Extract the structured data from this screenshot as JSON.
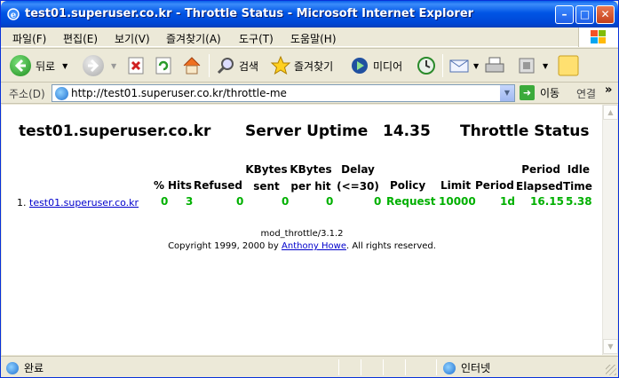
{
  "window": {
    "title": "test01.superuser.co.kr - Throttle Status - Microsoft Internet Explorer",
    "min_glyph": "–",
    "max_glyph": "□",
    "close_glyph": "✕"
  },
  "menu": {
    "items": [
      "파일(F)",
      "편집(E)",
      "보기(V)",
      "즐겨찾기(A)",
      "도구(T)",
      "도움말(H)"
    ]
  },
  "toolbar": {
    "back_label": "뒤로",
    "search_label": "검색",
    "favorites_label": "즐겨찾기",
    "media_label": "미디어"
  },
  "address": {
    "label": "주소(D)",
    "url": "http://test01.superuser.co.kr/throttle-me",
    "go_label": "이동",
    "links_label": "연결"
  },
  "page": {
    "server_name": "test01.superuser.co.kr",
    "uptime_label": "Server Uptime",
    "uptime_value": "14.35",
    "status_title": "Throttle Status",
    "columns": {
      "pct": "%",
      "hits": "Hits",
      "refused": "Refused",
      "kbytes_sent_1": "KBytes",
      "kbytes_sent_2": "sent",
      "kbytes_per_hit_1": "KBytes",
      "kbytes_per_hit_2": "per hit",
      "delay_1": "Delay",
      "delay_2": "(<=30)",
      "policy": "Policy",
      "limit": "Limit",
      "period": "Period",
      "period_elapsed_1": "Period",
      "period_elapsed_2": "Elapsed",
      "idle_time_1": "Idle",
      "idle_time_2": "Time"
    },
    "rows": [
      {
        "index": "1.",
        "host": "test01.superuser.co.kr",
        "pct": "0",
        "hits": "3",
        "refused": "0",
        "kbytes_sent": "0",
        "kbytes_per_hit": "0",
        "delay": "0",
        "policy": "Request",
        "limit": "10000",
        "period": "1d",
        "period_elapsed": "16.15",
        "idle_time": "5.38"
      }
    ],
    "footer_version": "mod_throttle/3.1.2",
    "footer_copyright_prefix": "Copyright 1999, 2000 by",
    "footer_author": "Anthony Howe",
    "footer_copyright_suffix": ". All rights reserved."
  },
  "status": {
    "text": "완료",
    "zone": "인터넷"
  },
  "colors": {
    "values": "#00B000",
    "link": "#0000CC",
    "titlebar": "#0055E5"
  }
}
